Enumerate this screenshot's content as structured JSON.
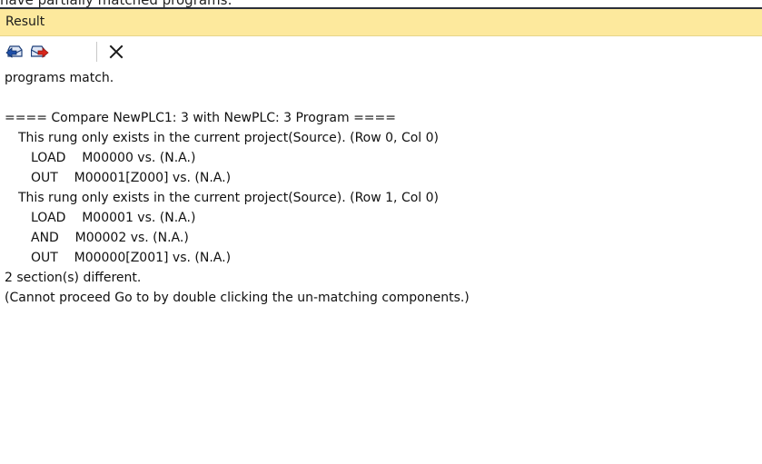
{
  "top_strip_text": "have partially matched programs:",
  "panel": {
    "title": "Result"
  },
  "toolbar": {
    "icons": [
      "previous-difference-icon",
      "next-difference-icon",
      "close-icon"
    ]
  },
  "result": {
    "lines": [
      "programs match.",
      "",
      "==== Compare NewPLC1: 3 with NewPLC: 3 Program ====",
      "This rung only exists in the current project(Source). (Row 0, Col 0)",
      "LOAD    M00000 vs. (N.A.)",
      "OUT    M00001[Z000] vs. (N.A.)",
      "This rung only exists in the current project(Source). (Row 1, Col 0)",
      "LOAD    M00001 vs. (N.A.)",
      "AND    M00002 vs. (N.A.)",
      "OUT    M00000[Z001] vs. (N.A.)",
      "2 section(s) different.",
      "(Cannot proceed Go to by double clicking the un-matching components.)"
    ]
  },
  "colors": {
    "title_bg": "#fde99d",
    "icon_blue": "#1e4fa8",
    "icon_red": "#d8261c"
  }
}
